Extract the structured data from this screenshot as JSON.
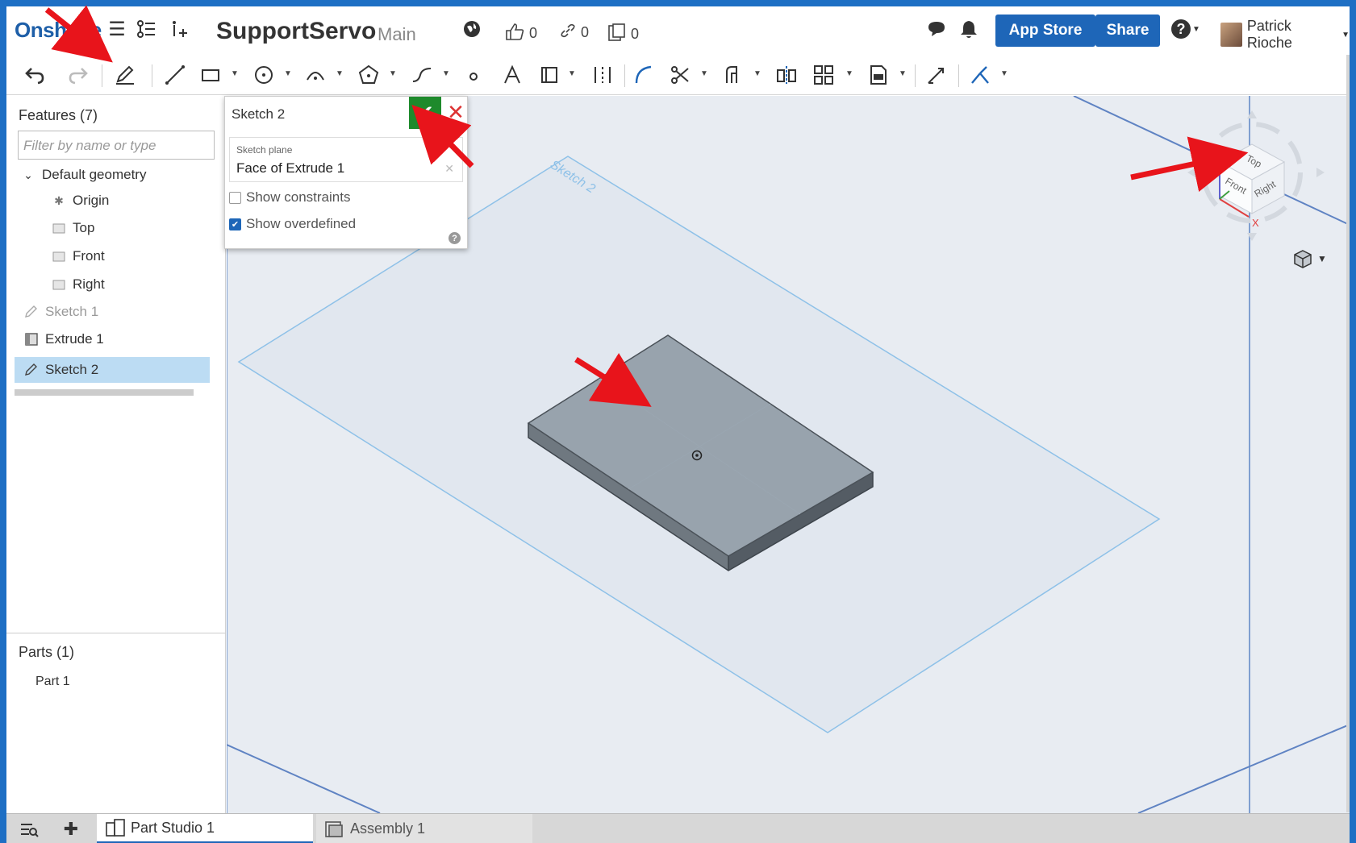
{
  "header": {
    "logo": "Onshape",
    "doc_title": "SupportServo",
    "branch": "Main",
    "likes": "0",
    "links": "0",
    "copies": "0",
    "app_store": "App Store",
    "share": "Share",
    "help": "?",
    "user_name": "Patrick Rioche"
  },
  "features": {
    "title": "Features (7)",
    "filter_placeholder": "Filter by name or type",
    "items": [
      {
        "label": "Default geometry",
        "icon": "chevron-down-icon"
      },
      {
        "label": "Origin",
        "icon": "origin-icon"
      },
      {
        "label": "Top",
        "icon": "plane-icon"
      },
      {
        "label": "Front",
        "icon": "plane-icon"
      },
      {
        "label": "Right",
        "icon": "plane-icon"
      },
      {
        "label": "Sketch 1",
        "icon": "sketch-icon"
      },
      {
        "label": "Extrude 1",
        "icon": "extrude-icon"
      },
      {
        "label": "Sketch 2",
        "icon": "sketch-icon"
      }
    ]
  },
  "parts": {
    "title": "Parts (1)",
    "items": [
      {
        "label": "Part 1"
      }
    ]
  },
  "dialog": {
    "title": "Sketch 2",
    "plane_label": "Sketch plane",
    "plane_value": "Face of Extrude 1",
    "show_constraints": "Show constraints",
    "show_constraints_checked": false,
    "show_overdefined": "Show overdefined",
    "show_overdefined_checked": true
  },
  "viewport": {
    "sketch_label": "Sketch 2",
    "viewcube": {
      "top": "Top",
      "front": "Front",
      "right": "Right",
      "axis_x": "X"
    }
  },
  "tabs": [
    {
      "label": "Part Studio 1",
      "active": true
    },
    {
      "label": "Assembly 1",
      "active": false
    }
  ],
  "colors": {
    "brand_blue": "#1e66b8",
    "ok_green": "#1e8a2c",
    "cancel_red": "#d33333",
    "selection": "#bcdcf3",
    "annotation_arrow": "#e8141b"
  }
}
